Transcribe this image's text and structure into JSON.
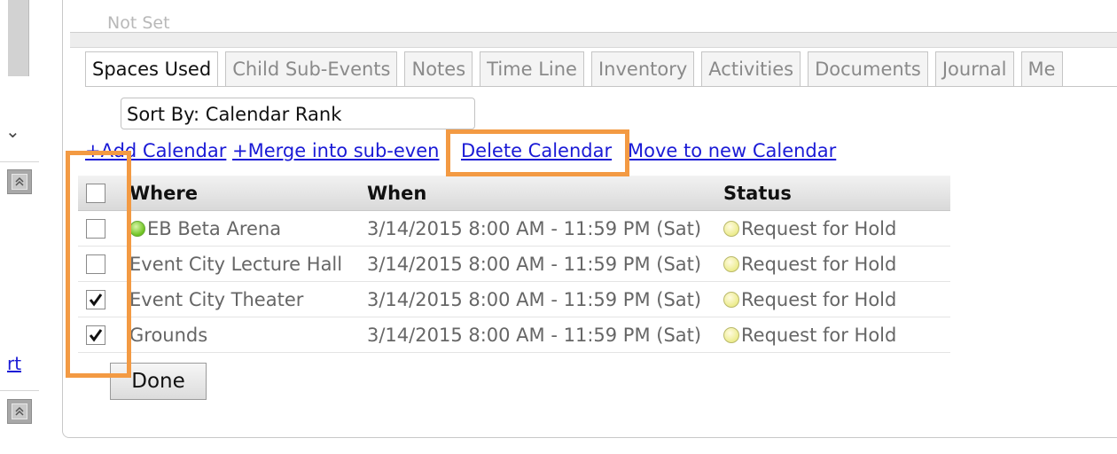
{
  "sidebar": {
    "chevron": "⌄",
    "collapse_icon": "double-chevron-up-icon",
    "link_fragment": "rt"
  },
  "panel": {
    "not_set_text": "Not Set"
  },
  "tabs": [
    {
      "label": "Spaces Used",
      "active": true
    },
    {
      "label": "Child Sub-Events",
      "active": false
    },
    {
      "label": "Notes",
      "active": false
    },
    {
      "label": "Time Line",
      "active": false
    },
    {
      "label": "Inventory",
      "active": false
    },
    {
      "label": "Activities",
      "active": false
    },
    {
      "label": "Documents",
      "active": false
    },
    {
      "label": "Journal",
      "active": false
    },
    {
      "label": "Me",
      "active": false
    }
  ],
  "sort": {
    "value": "Sort By: Calendar Rank"
  },
  "actions": {
    "add_calendar": "+Add Calendar",
    "merge": "+Merge into sub-even",
    "delete_calendar": "Delete Calendar",
    "move": "Move to new Calendar"
  },
  "table": {
    "headers": {
      "where": "Where",
      "when": "When",
      "status": "Status"
    },
    "rows": [
      {
        "where": "EB Beta Arena",
        "when": "3/14/2015 8:00 AM - 11:59 PM (Sat)",
        "status": "Request for Hold",
        "checked": false,
        "where_dot": "green"
      },
      {
        "where": "Event City Lecture Hall",
        "when": "3/14/2015 8:00 AM - 11:59 PM (Sat)",
        "status": "Request for Hold",
        "checked": false,
        "where_dot": ""
      },
      {
        "where": "Event City Theater",
        "when": "3/14/2015 8:00 AM - 11:59 PM (Sat)",
        "status": "Request for Hold",
        "checked": true,
        "where_dot": ""
      },
      {
        "where": "Grounds",
        "when": "3/14/2015 8:00 AM - 11:59 PM (Sat)",
        "status": "Request for Hold",
        "checked": true,
        "where_dot": ""
      }
    ]
  },
  "done_label": "Done",
  "colors": {
    "link": "#1a1ad6",
    "highlight": "#f39a43",
    "status_dot": "#ecec8e",
    "location_dot": "#6cc21e"
  }
}
